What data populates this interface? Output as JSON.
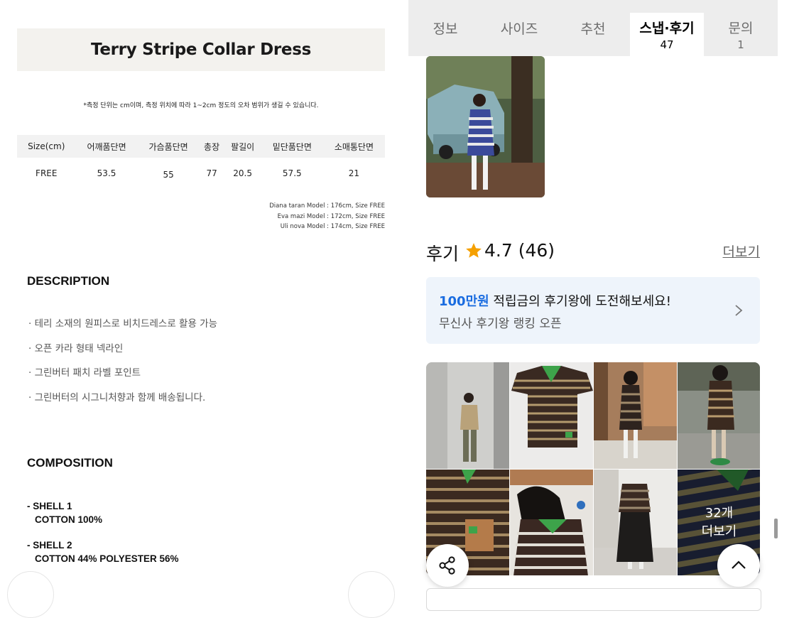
{
  "product": {
    "title": "Terry Stripe Collar Dress",
    "measure_note": "*측정 단위는 cm이며, 측정 위치에 따라 1~2cm 정도의 오차 범위가 생길 수 있습니다.",
    "size_table": {
      "headers": [
        "Size(cm)",
        "어깨품단면",
        "가슴품단면",
        "총장",
        "팔길이",
        "밑단품단면",
        "소매통단면"
      ],
      "rows": [
        [
          "FREE",
          "53.5",
          "55",
          "77",
          "20.5",
          "57.5",
          "21"
        ]
      ]
    },
    "models": [
      "Diana taran Model : 176cm, Size FREE",
      "Eva mazi Model : 172cm, Size FREE",
      "Uli nova Model : 174cm, Size FREE"
    ],
    "description_title": "DESCRIPTION",
    "description": [
      "· 테리 소재의 원피스로 비치드레스로 활용  가능",
      "· 오픈 카라 형태 넥라인",
      "· 그린버터 패치 라벨 포인트",
      "· 그린버터의 시그니처향과 함께 배송됩니다."
    ],
    "composition_title": "COMPOSITION",
    "composition": {
      "shell1_label": "- SHELL 1",
      "shell1_value": "COTTON 100%",
      "shell2_label": "- SHELL 2",
      "shell2_value": "COTTON 44% POLYESTER 56%"
    }
  },
  "tabs": [
    {
      "label": "정보",
      "count": ""
    },
    {
      "label": "사이즈",
      "count": ""
    },
    {
      "label": "추천",
      "count": ""
    },
    {
      "label": "스냅·후기",
      "count": "47",
      "active": true
    },
    {
      "label": "문의",
      "count": "1"
    }
  ],
  "reviews": {
    "label": "후기",
    "rating": "4.7",
    "count": "(46)",
    "more_link": "더보기",
    "star_icon": "star-icon",
    "star_color": "#f5a000"
  },
  "promo": {
    "highlight": "100만원",
    "line1_rest": " 적립금의 후기왕에 도전해보세요!",
    "line2": "무신사 후기왕 랭킹 오픈",
    "accent": "#1a6ce0"
  },
  "photo_grid": {
    "more_count": "32개",
    "more_label": "더보기"
  },
  "icons": {
    "share": "share-icon",
    "scroll_top": "chevron-up-icon",
    "promo_arrow": "chevron-right-icon"
  }
}
